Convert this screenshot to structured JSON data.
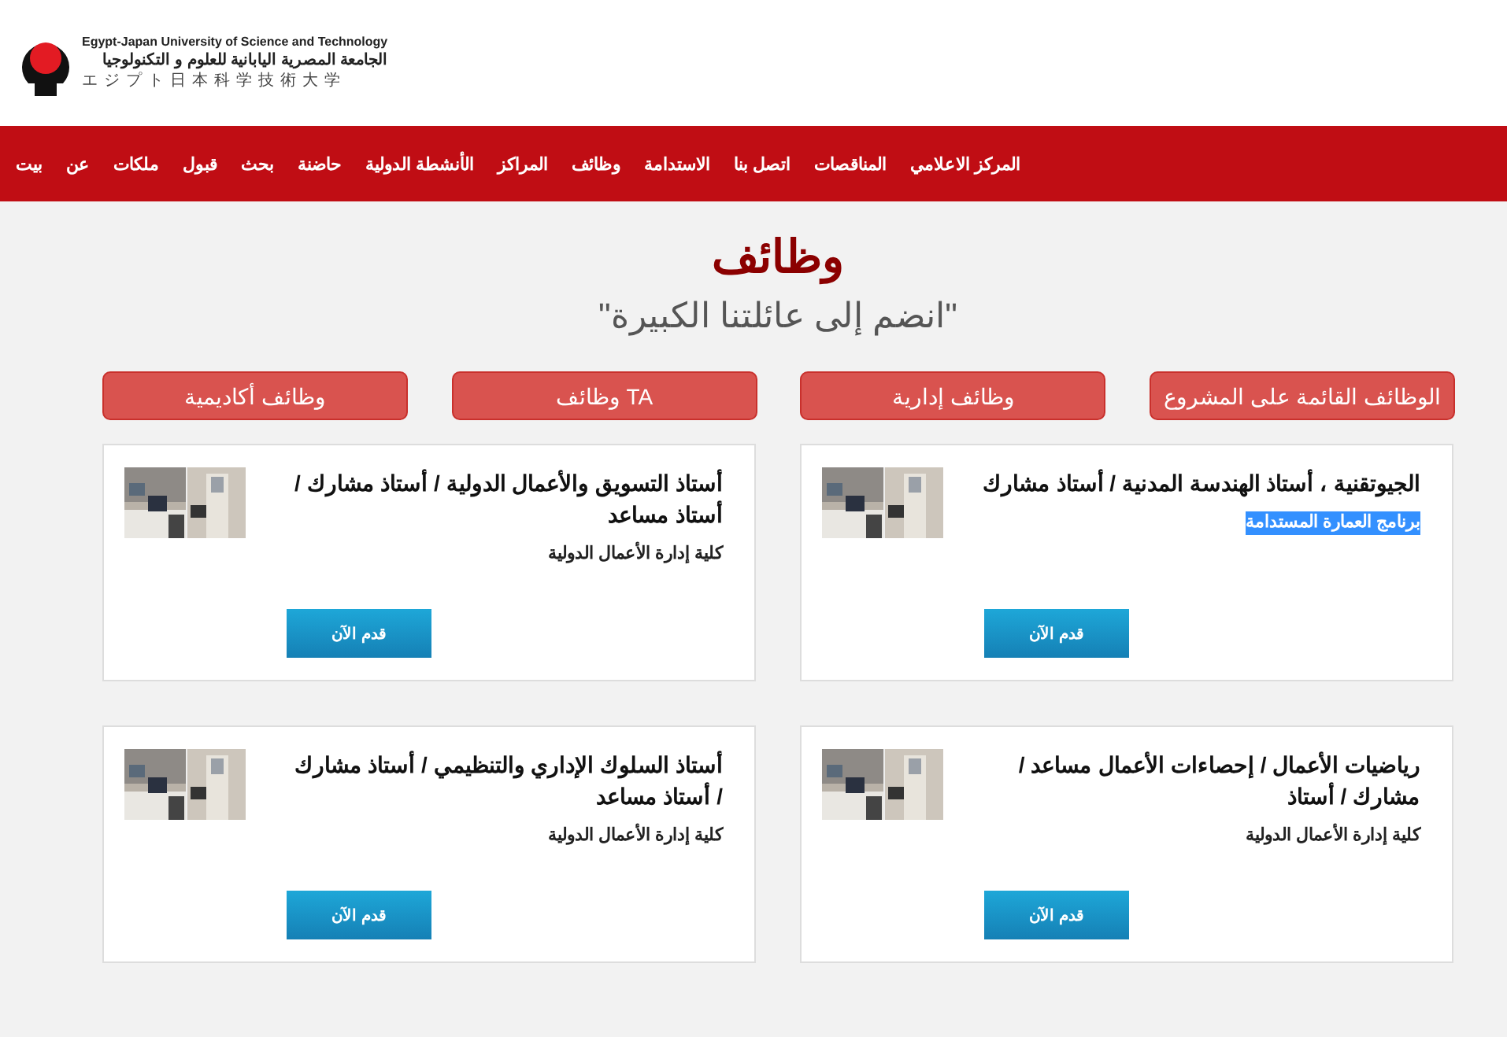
{
  "header": {
    "logo_lines": [
      "Egypt-Japan University of Science and Technology",
      "الجامعة المصرية اليابانية للعلوم و التكنولوجيا",
      "エジプト日本科学技術大学"
    ]
  },
  "nav": [
    "المركز الاعلامي",
    "المناقصات",
    "اتصل بنا",
    "الاستدامة",
    "وظائف",
    "المراكز",
    "الأنشطة الدولية",
    "حاضنة",
    "بحث",
    "قبول",
    "ملكات",
    "عن",
    "بيت"
  ],
  "page": {
    "title": "وظائف",
    "subtitle": "\"انضم إلى عائلتنا الكبيرة\""
  },
  "categories": [
    "الوظائف القائمة على المشروع",
    "وظائف إدارية",
    "TA وظائف",
    "وظائف أكاديمية"
  ],
  "jobs": [
    {
      "title": "الجيوتقنية ، أستاذ الهندسة المدنية / أستاذ مشارك",
      "department": "برنامج العمارة المستدامة",
      "highlighted": true,
      "button": "قدم الآن"
    },
    {
      "title": "أستاذ التسويق والأعمال الدولية / أستاذ مشارك / أستاذ مساعد",
      "department": "كلية إدارة الأعمال الدولية",
      "highlighted": false,
      "button": "قدم الآن"
    },
    {
      "title": "رياضيات الأعمال / إحصاءات الأعمال مساعد / مشارك / أستاذ",
      "department": "كلية إدارة الأعمال الدولية",
      "highlighted": false,
      "button": "قدم الآن"
    },
    {
      "title": "أستاذ السلوك الإداري والتنظيمي / أستاذ مشارك / أستاذ مساعد",
      "department": "كلية إدارة الأعمال الدولية",
      "highlighted": false,
      "button": "قدم الآن"
    }
  ]
}
